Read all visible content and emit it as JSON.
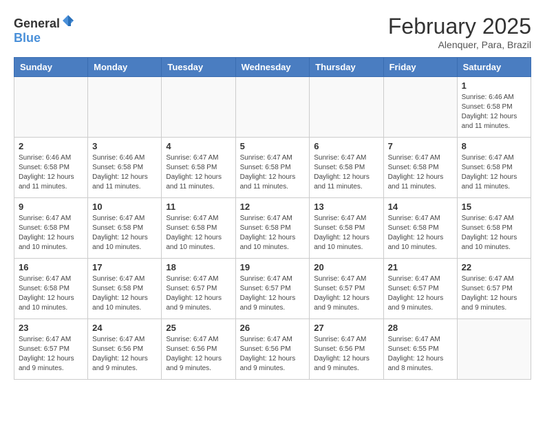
{
  "header": {
    "logo_general": "General",
    "logo_blue": "Blue",
    "month_year": "February 2025",
    "location": "Alenquer, Para, Brazil"
  },
  "calendar": {
    "days_of_week": [
      "Sunday",
      "Monday",
      "Tuesday",
      "Wednesday",
      "Thursday",
      "Friday",
      "Saturday"
    ],
    "weeks": [
      [
        {
          "day": "",
          "info": ""
        },
        {
          "day": "",
          "info": ""
        },
        {
          "day": "",
          "info": ""
        },
        {
          "day": "",
          "info": ""
        },
        {
          "day": "",
          "info": ""
        },
        {
          "day": "",
          "info": ""
        },
        {
          "day": "1",
          "info": "Sunrise: 6:46 AM\nSunset: 6:58 PM\nDaylight: 12 hours\nand 11 minutes."
        }
      ],
      [
        {
          "day": "2",
          "info": "Sunrise: 6:46 AM\nSunset: 6:58 PM\nDaylight: 12 hours\nand 11 minutes."
        },
        {
          "day": "3",
          "info": "Sunrise: 6:46 AM\nSunset: 6:58 PM\nDaylight: 12 hours\nand 11 minutes."
        },
        {
          "day": "4",
          "info": "Sunrise: 6:47 AM\nSunset: 6:58 PM\nDaylight: 12 hours\nand 11 minutes."
        },
        {
          "day": "5",
          "info": "Sunrise: 6:47 AM\nSunset: 6:58 PM\nDaylight: 12 hours\nand 11 minutes."
        },
        {
          "day": "6",
          "info": "Sunrise: 6:47 AM\nSunset: 6:58 PM\nDaylight: 12 hours\nand 11 minutes."
        },
        {
          "day": "7",
          "info": "Sunrise: 6:47 AM\nSunset: 6:58 PM\nDaylight: 12 hours\nand 11 minutes."
        },
        {
          "day": "8",
          "info": "Sunrise: 6:47 AM\nSunset: 6:58 PM\nDaylight: 12 hours\nand 11 minutes."
        }
      ],
      [
        {
          "day": "9",
          "info": "Sunrise: 6:47 AM\nSunset: 6:58 PM\nDaylight: 12 hours\nand 10 minutes."
        },
        {
          "day": "10",
          "info": "Sunrise: 6:47 AM\nSunset: 6:58 PM\nDaylight: 12 hours\nand 10 minutes."
        },
        {
          "day": "11",
          "info": "Sunrise: 6:47 AM\nSunset: 6:58 PM\nDaylight: 12 hours\nand 10 minutes."
        },
        {
          "day": "12",
          "info": "Sunrise: 6:47 AM\nSunset: 6:58 PM\nDaylight: 12 hours\nand 10 minutes."
        },
        {
          "day": "13",
          "info": "Sunrise: 6:47 AM\nSunset: 6:58 PM\nDaylight: 12 hours\nand 10 minutes."
        },
        {
          "day": "14",
          "info": "Sunrise: 6:47 AM\nSunset: 6:58 PM\nDaylight: 12 hours\nand 10 minutes."
        },
        {
          "day": "15",
          "info": "Sunrise: 6:47 AM\nSunset: 6:58 PM\nDaylight: 12 hours\nand 10 minutes."
        }
      ],
      [
        {
          "day": "16",
          "info": "Sunrise: 6:47 AM\nSunset: 6:58 PM\nDaylight: 12 hours\nand 10 minutes."
        },
        {
          "day": "17",
          "info": "Sunrise: 6:47 AM\nSunset: 6:58 PM\nDaylight: 12 hours\nand 10 minutes."
        },
        {
          "day": "18",
          "info": "Sunrise: 6:47 AM\nSunset: 6:57 PM\nDaylight: 12 hours\nand 9 minutes."
        },
        {
          "day": "19",
          "info": "Sunrise: 6:47 AM\nSunset: 6:57 PM\nDaylight: 12 hours\nand 9 minutes."
        },
        {
          "day": "20",
          "info": "Sunrise: 6:47 AM\nSunset: 6:57 PM\nDaylight: 12 hours\nand 9 minutes."
        },
        {
          "day": "21",
          "info": "Sunrise: 6:47 AM\nSunset: 6:57 PM\nDaylight: 12 hours\nand 9 minutes."
        },
        {
          "day": "22",
          "info": "Sunrise: 6:47 AM\nSunset: 6:57 PM\nDaylight: 12 hours\nand 9 minutes."
        }
      ],
      [
        {
          "day": "23",
          "info": "Sunrise: 6:47 AM\nSunset: 6:57 PM\nDaylight: 12 hours\nand 9 minutes."
        },
        {
          "day": "24",
          "info": "Sunrise: 6:47 AM\nSunset: 6:56 PM\nDaylight: 12 hours\nand 9 minutes."
        },
        {
          "day": "25",
          "info": "Sunrise: 6:47 AM\nSunset: 6:56 PM\nDaylight: 12 hours\nand 9 minutes."
        },
        {
          "day": "26",
          "info": "Sunrise: 6:47 AM\nSunset: 6:56 PM\nDaylight: 12 hours\nand 9 minutes."
        },
        {
          "day": "27",
          "info": "Sunrise: 6:47 AM\nSunset: 6:56 PM\nDaylight: 12 hours\nand 9 minutes."
        },
        {
          "day": "28",
          "info": "Sunrise: 6:47 AM\nSunset: 6:55 PM\nDaylight: 12 hours\nand 8 minutes."
        },
        {
          "day": "",
          "info": ""
        }
      ]
    ]
  }
}
